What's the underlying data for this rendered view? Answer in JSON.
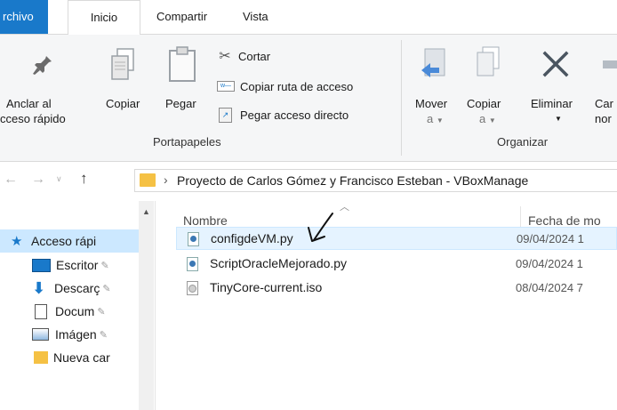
{
  "tabs": {
    "archivo": "rchivo",
    "inicio": "Inicio",
    "compartir": "Compartir",
    "vista": "Vista"
  },
  "ribbon": {
    "pin": {
      "line1": "Anclar al",
      "line2": "cceso rápido"
    },
    "copy": "Copiar",
    "paste": "Pegar",
    "cut": "Cortar",
    "copy_path": "Copiar ruta de acceso",
    "paste_shortcut": "Pegar acceso directo",
    "group_clipboard": "Portapapeles",
    "move": {
      "line1": "Mover",
      "line2": "a"
    },
    "copy_to": {
      "line1": "Copiar",
      "line2": "a"
    },
    "delete": "Eliminar",
    "rename": {
      "line1": "Car",
      "line2": "nor"
    },
    "group_organize": "Organizar"
  },
  "address": {
    "separator": "›",
    "path": "Proyecto de Carlos Gómez y Francisco Esteban - VBoxManage"
  },
  "nav": {
    "items": [
      {
        "label": "Acceso rápi",
        "icon": "star-icon"
      },
      {
        "label": "Escritor",
        "icon": "desktop-icon"
      },
      {
        "label": "Descarç",
        "icon": "download-icon"
      },
      {
        "label": "Docum",
        "icon": "documents-icon"
      },
      {
        "label": "Imágen",
        "icon": "pictures-icon"
      },
      {
        "label": "Nueva car",
        "icon": "folder-icon"
      }
    ]
  },
  "list": {
    "col_name": "Nombre",
    "col_date": "Fecha de mo",
    "files": [
      {
        "name": "configdeVM.py",
        "date": "09/04/2024 1",
        "type": "python"
      },
      {
        "name": "ScriptOracleMejorado.py",
        "date": "09/04/2024 1",
        "type": "python"
      },
      {
        "name": "TinyCore-current.iso",
        "date": "08/04/2024 7",
        "type": "iso"
      }
    ]
  },
  "colors": {
    "accent": "#1979ca",
    "selected_row": "#e5f3ff",
    "hover_border": "#cce8ff",
    "folder": "#f5c144"
  }
}
